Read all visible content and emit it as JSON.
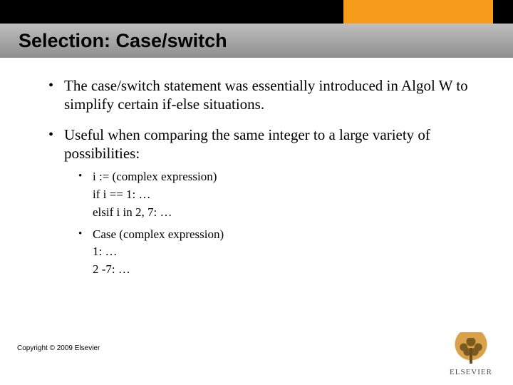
{
  "header": {
    "title": "Selection: Case/switch"
  },
  "bullets": [
    {
      "text": "The case/switch statement was essentially introduced in Algol W to simplify certain if-else situations."
    },
    {
      "text": "Useful when comparing the same integer to a large variety of possibilities:",
      "sub": [
        {
          "line1": "i := (complex expression)",
          "line2": "if i == 1: …",
          "line3": "elsif i in 2, 7: …"
        },
        {
          "line1": "Case (complex expression)",
          "line2": "1: …",
          "line3": "2 -7: …"
        }
      ]
    }
  ],
  "footer": {
    "copyright": "Copyright © 2009 Elsevier",
    "logo_text": "ELSEVIER"
  }
}
